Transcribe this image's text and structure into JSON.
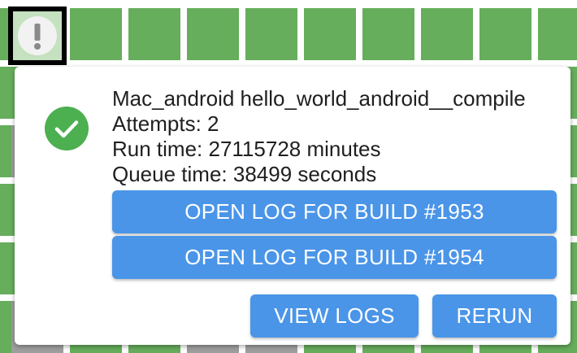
{
  "task_grid": {
    "selected_cell_icon": "alert-icon",
    "cell_status_colors": {
      "succeeded": "#66ad5c",
      "skipped": "#9e9e9e"
    }
  },
  "task_card": {
    "status_icon": "check-icon",
    "status_color": "#4caf50",
    "task_name": "Mac_android hello_world_android__compile",
    "attempts_text": "Attempts: 2",
    "run_time_text": "Run time: 27115728 minutes",
    "queue_time_text": "Queue time: 38499 seconds",
    "log_buttons": [
      {
        "label": "OPEN LOG FOR BUILD #1953"
      },
      {
        "label": "OPEN LOG FOR BUILD #1954"
      }
    ],
    "view_logs_label": "VIEW LOGS",
    "rerun_label": "RERUN",
    "button_color": "#4a95e8"
  }
}
